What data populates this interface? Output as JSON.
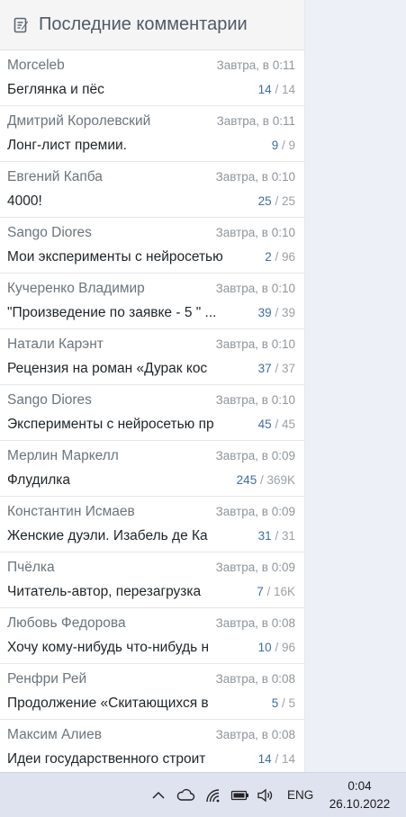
{
  "header": {
    "title": "Последние комментарии",
    "icon": "notepad-edit-icon"
  },
  "comments": [
    {
      "author": "Morceleb",
      "time": "Завтра, в 0:11",
      "topic": "Беглянка и пёс",
      "new": "14",
      "total": "14"
    },
    {
      "author": "Дмитрий Королевский",
      "time": "Завтра, в 0:11",
      "topic": "Лонг-лист премии.",
      "new": "9",
      "total": "9"
    },
    {
      "author": "Евгений Капба",
      "time": "Завтра, в 0:10",
      "topic": "4000!",
      "new": "25",
      "total": "25"
    },
    {
      "author": "Sango Diores",
      "time": "Завтра, в 0:10",
      "topic": "Мои эксперименты с нейросетью",
      "new": "2",
      "total": "96"
    },
    {
      "author": "Кучеренко Владимир",
      "time": "Завтра, в 0:10",
      "topic": "\"Произведение по заявке - 5 \" ...",
      "new": "39",
      "total": "39"
    },
    {
      "author": "Натали Карэнт",
      "time": "Завтра, в 0:10",
      "topic": "Рецензия на роман «Дурак кос",
      "new": "37",
      "total": "37"
    },
    {
      "author": "Sango Diores",
      "time": "Завтра, в 0:10",
      "topic": "Эксперименты с нейросетью пр",
      "new": "45",
      "total": "45"
    },
    {
      "author": "Мерлин Маркелл",
      "time": "Завтра, в 0:09",
      "topic": "Флудилка",
      "new": "245",
      "total": "369K"
    },
    {
      "author": "Константин Исмаев",
      "time": "Завтра, в 0:09",
      "topic": "Женские дуэли. Изабель де Ка",
      "new": "31",
      "total": "31"
    },
    {
      "author": "Пчёлка",
      "time": "Завтра, в 0:09",
      "topic": "Читатель-автор, перезагрузка",
      "new": "7",
      "total": "16K"
    },
    {
      "author": "Любовь Федорова",
      "time": "Завтра, в 0:08",
      "topic": "Хочу кому-нибудь что-нибудь н",
      "new": "10",
      "total": "96"
    },
    {
      "author": "Ренфри Рей",
      "time": "Завтра, в 0:08",
      "topic": "Продолжение «Скитающихся в",
      "new": "5",
      "total": "5"
    },
    {
      "author": "Максим Алиев",
      "time": "Завтра, в 0:08",
      "topic": "Идеи государственного строит",
      "new": "14",
      "total": "14"
    }
  ],
  "taskbar": {
    "language": "ENG",
    "time": "0:04",
    "date": "26.10.2022",
    "icons": [
      "chevron-up-icon",
      "cloud-icon",
      "wifi-icon",
      "battery-icon",
      "volume-icon"
    ]
  },
  "colors": {
    "accent": "#3a6ea5",
    "header_bg": "#f5f5f5",
    "page_bg": "#eef0f8"
  }
}
